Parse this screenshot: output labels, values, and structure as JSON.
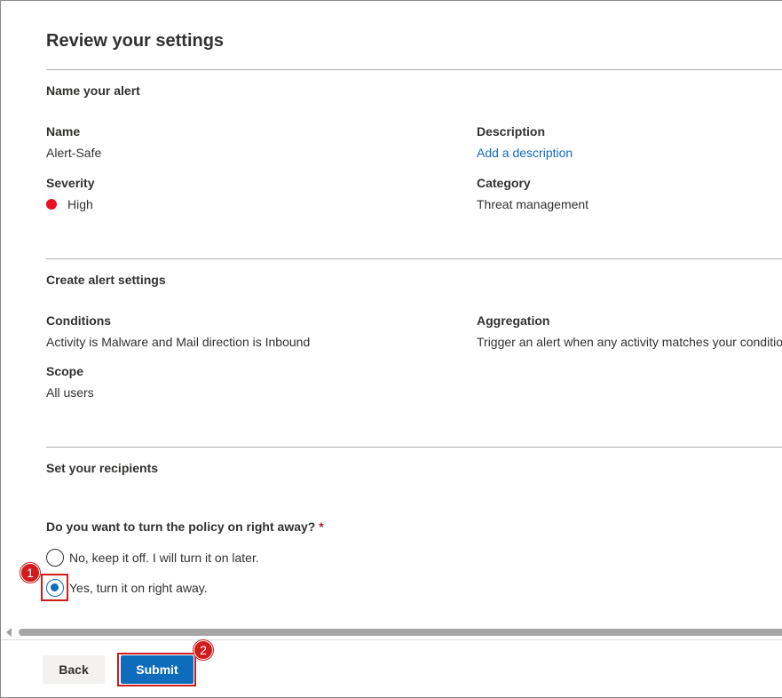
{
  "page": {
    "title": "Review your settings"
  },
  "name_section": {
    "title": "Name your alert",
    "name_label": "Name",
    "name_value": "Alert-Safe",
    "description_label": "Description",
    "description_link": "Add a description",
    "severity_label": "Severity",
    "severity_value": "High",
    "severity_color": "#e81123",
    "category_label": "Category",
    "category_value": "Threat management"
  },
  "alert_settings_section": {
    "title": "Create alert settings",
    "conditions_label": "Conditions",
    "conditions_value": "Activity is Malware and Mail direction is Inbound",
    "aggregation_label": "Aggregation",
    "aggregation_value": "Trigger an alert when any activity matches your conditio",
    "scope_label": "Scope",
    "scope_value": "All users"
  },
  "recipients_section": {
    "title": "Set your recipients",
    "question": "Do you want to turn the policy on right away?",
    "required_marker": "*",
    "options": [
      {
        "label": "No, keep it off. I will turn it on later.",
        "selected": false
      },
      {
        "label": "Yes, turn it on right away.",
        "selected": true
      }
    ]
  },
  "annotations": {
    "step1": "1",
    "step2": "2",
    "highlight_color": "#d01c1c"
  },
  "footer": {
    "back_label": "Back",
    "submit_label": "Submit",
    "accent_color": "#0f6cbd"
  }
}
